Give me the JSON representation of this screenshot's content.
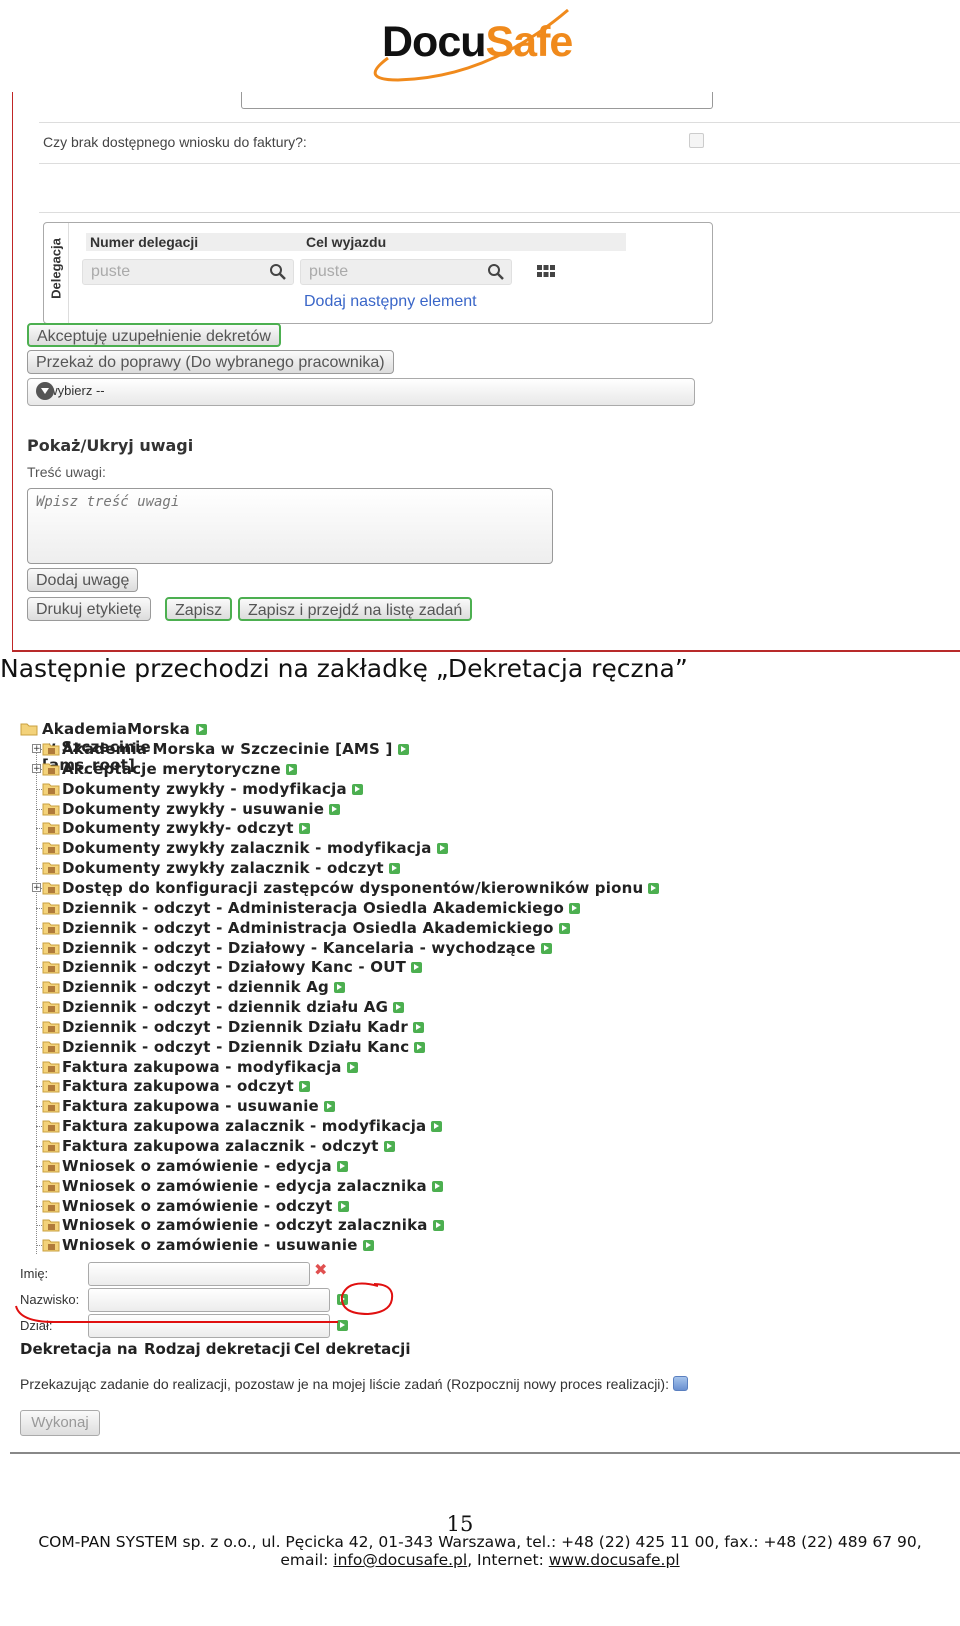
{
  "logo": {
    "part1": "Docu",
    "part2": "Safe"
  },
  "form1": {
    "question": "Czy brak dostępnego wniosku do faktury?:",
    "delegation_section": "Delegacja",
    "col_number": "Numer delegacji",
    "col_purpose": "Cel wyjazdu",
    "input_number": "puste",
    "input_purpose": "puste",
    "add_element": "Dodaj następny element",
    "btn_accept": "Akceptuję uzupełnienie dekretów",
    "btn_return": "Przekaż do poprawy (Do wybranego pracownika)",
    "select_value": "-- wybierz --",
    "notes_toggle": "Pokaż/Ukryj uwagi",
    "notes_label": "Treść uwagi:",
    "notes_placeholder": "Wpisz treść uwagi",
    "btn_add_note": "Dodaj uwagę",
    "btn_print": "Drukuj etykietę",
    "btn_save": "Zapisz",
    "btn_save_go": "Zapisz i przejdź na listę zadań"
  },
  "caption": "Następnie przechodzi na zakładkę „Dekretacja ręczna”",
  "tree": {
    "root": "AkademiaMorska w Szczecinie [ams_root]",
    "items": [
      {
        "label": "Akademia Morska w Szczecinie [AMS ]",
        "expandable": true
      },
      {
        "label": "Akceptacje merytoryczne",
        "expandable": true
      },
      {
        "label": "Dokumenty zwykły - modyfikacja",
        "expandable": false
      },
      {
        "label": "Dokumenty zwykły - usuwanie",
        "expandable": false
      },
      {
        "label": "Dokumenty zwykły- odczyt",
        "expandable": false
      },
      {
        "label": "Dokumenty zwykły zalacznik - modyfikacja",
        "expandable": false
      },
      {
        "label": "Dokumenty zwykły zalacznik - odczyt",
        "expandable": false
      },
      {
        "label": "Dostęp do konfiguracji zastępców dysponentów/kierowników pionu",
        "expandable": true
      },
      {
        "label": "Dziennik - odczyt - Administeracja Osiedla Akademickiego",
        "expandable": false
      },
      {
        "label": "Dziennik - odczyt - Administracja Osiedla Akademickiego",
        "expandable": false
      },
      {
        "label": "Dziennik - odczyt - Działowy - Kancelaria - wychodzące",
        "expandable": false
      },
      {
        "label": "Dziennik - odczyt - Działowy Kanc - OUT",
        "expandable": false
      },
      {
        "label": "Dziennik - odczyt - dziennik Ag",
        "expandable": false
      },
      {
        "label": "Dziennik - odczyt - dziennik działu AG",
        "expandable": false
      },
      {
        "label": "Dziennik - odczyt - Dziennik Działu Kadr",
        "expandable": false
      },
      {
        "label": "Dziennik - odczyt - Dziennik Działu Kanc",
        "expandable": false
      },
      {
        "label": "Faktura zakupowa - modyfikacja",
        "expandable": false
      },
      {
        "label": "Faktura zakupowa - odczyt",
        "expandable": false
      },
      {
        "label": "Faktura zakupowa - usuwanie",
        "expandable": false
      },
      {
        "label": "Faktura zakupowa zalacznik - modyfikacja",
        "expandable": false
      },
      {
        "label": "Faktura zakupowa zalacznik - odczyt",
        "expandable": false
      },
      {
        "label": "Wniosek o zamówienie - edycja",
        "expandable": false
      },
      {
        "label": "Wniosek o zamówienie - edycja zalacznika",
        "expandable": false
      },
      {
        "label": "Wniosek o zamówienie - odczyt",
        "expandable": false
      },
      {
        "label": "Wniosek o zamówienie - odczyt zalacznika",
        "expandable": false
      },
      {
        "label": "Wniosek o zamówienie - usuwanie",
        "expandable": false
      }
    ]
  },
  "form2": {
    "label_name": "Imię:",
    "label_surname": "Nazwisko:",
    "label_dept": "Dział:",
    "col_decree_to": "Dekretacja na",
    "col_decree_type": "Rodzaj dekretacji",
    "col_decree_goal": "Cel dekretacji",
    "pass_task": "Przekazując zadanie do realizacji, pozostaw je na mojej liście zadań (Rozpocznij nowy proces realizacji):",
    "btn_execute": "Wykonaj"
  },
  "footer": {
    "page_number": "15",
    "line1": "COM-PAN SYSTEM sp. z o.o., ul. Pęcicka 42, 01-343 Warszawa, tel.: +48 (22) 425 11 00, fax.: +48 (22) 489 67 90,",
    "email_prefix": "email: ",
    "email": "info@docusafe.pl",
    "internet_prefix": ", Internet: ",
    "website": "www.docusafe.pl"
  },
  "colors": {
    "brand_orange": "#f08a1c",
    "link_blue": "#3a66c8",
    "accent_green": "#4caf50",
    "border_red": "#b82a2a"
  }
}
